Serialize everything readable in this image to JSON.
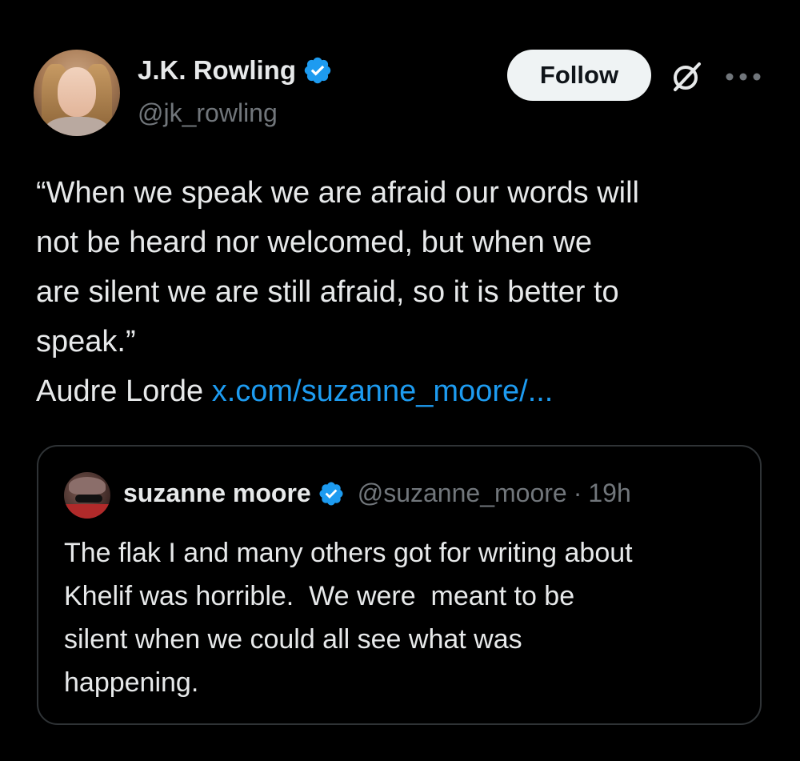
{
  "author": {
    "display_name": "J.K. Rowling",
    "handle": "@jk_rowling",
    "verified_icon": "verified-badge-icon",
    "avatar": "profile-photo"
  },
  "actions": {
    "follow_label": "Follow",
    "grok_icon": "grok-icon",
    "more_icon": "more-options-icon"
  },
  "tweet": {
    "lines": [
      "“When we speak we are afraid our words will",
      "not be heard nor welcomed, but when we",
      "are silent we are still afraid, so it is better to",
      "speak.”"
    ],
    "attribution": "Audre Lorde ",
    "link": "x.com/suzanne_moore/..."
  },
  "quoted": {
    "display_name": "suzanne moore",
    "handle": "@suzanne_moore",
    "separator": "·",
    "time": "19h",
    "lines": [
      "The flak I and many others got for writing about",
      "Khelif was horrible.  We were  meant to be",
      "silent when we could all see what was",
      "happening."
    ]
  },
  "colors": {
    "background": "#000000",
    "text": "#e7e9ea",
    "secondary_text": "#71767b",
    "link": "#1d9bf0",
    "verified": "#1d9bf0",
    "border": "#2f3336",
    "follow_bg": "#eff3f4"
  }
}
